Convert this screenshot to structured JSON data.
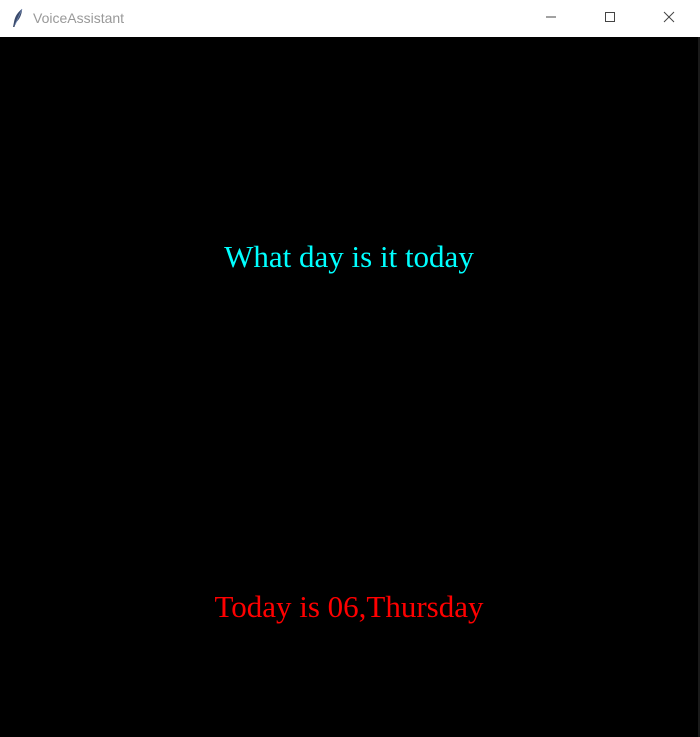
{
  "window": {
    "title": "VoiceAssistant",
    "icon": "feather-icon",
    "controls": {
      "minimize_icon": "minimize-icon",
      "maximize_icon": "maximize-icon",
      "close_icon": "close-icon"
    }
  },
  "canvas": {
    "background": "#000000",
    "query_text": "What day is it today",
    "query_color": "#00ffff",
    "answer_text": "Today is 06,Thursday",
    "answer_color": "#ff0000"
  }
}
